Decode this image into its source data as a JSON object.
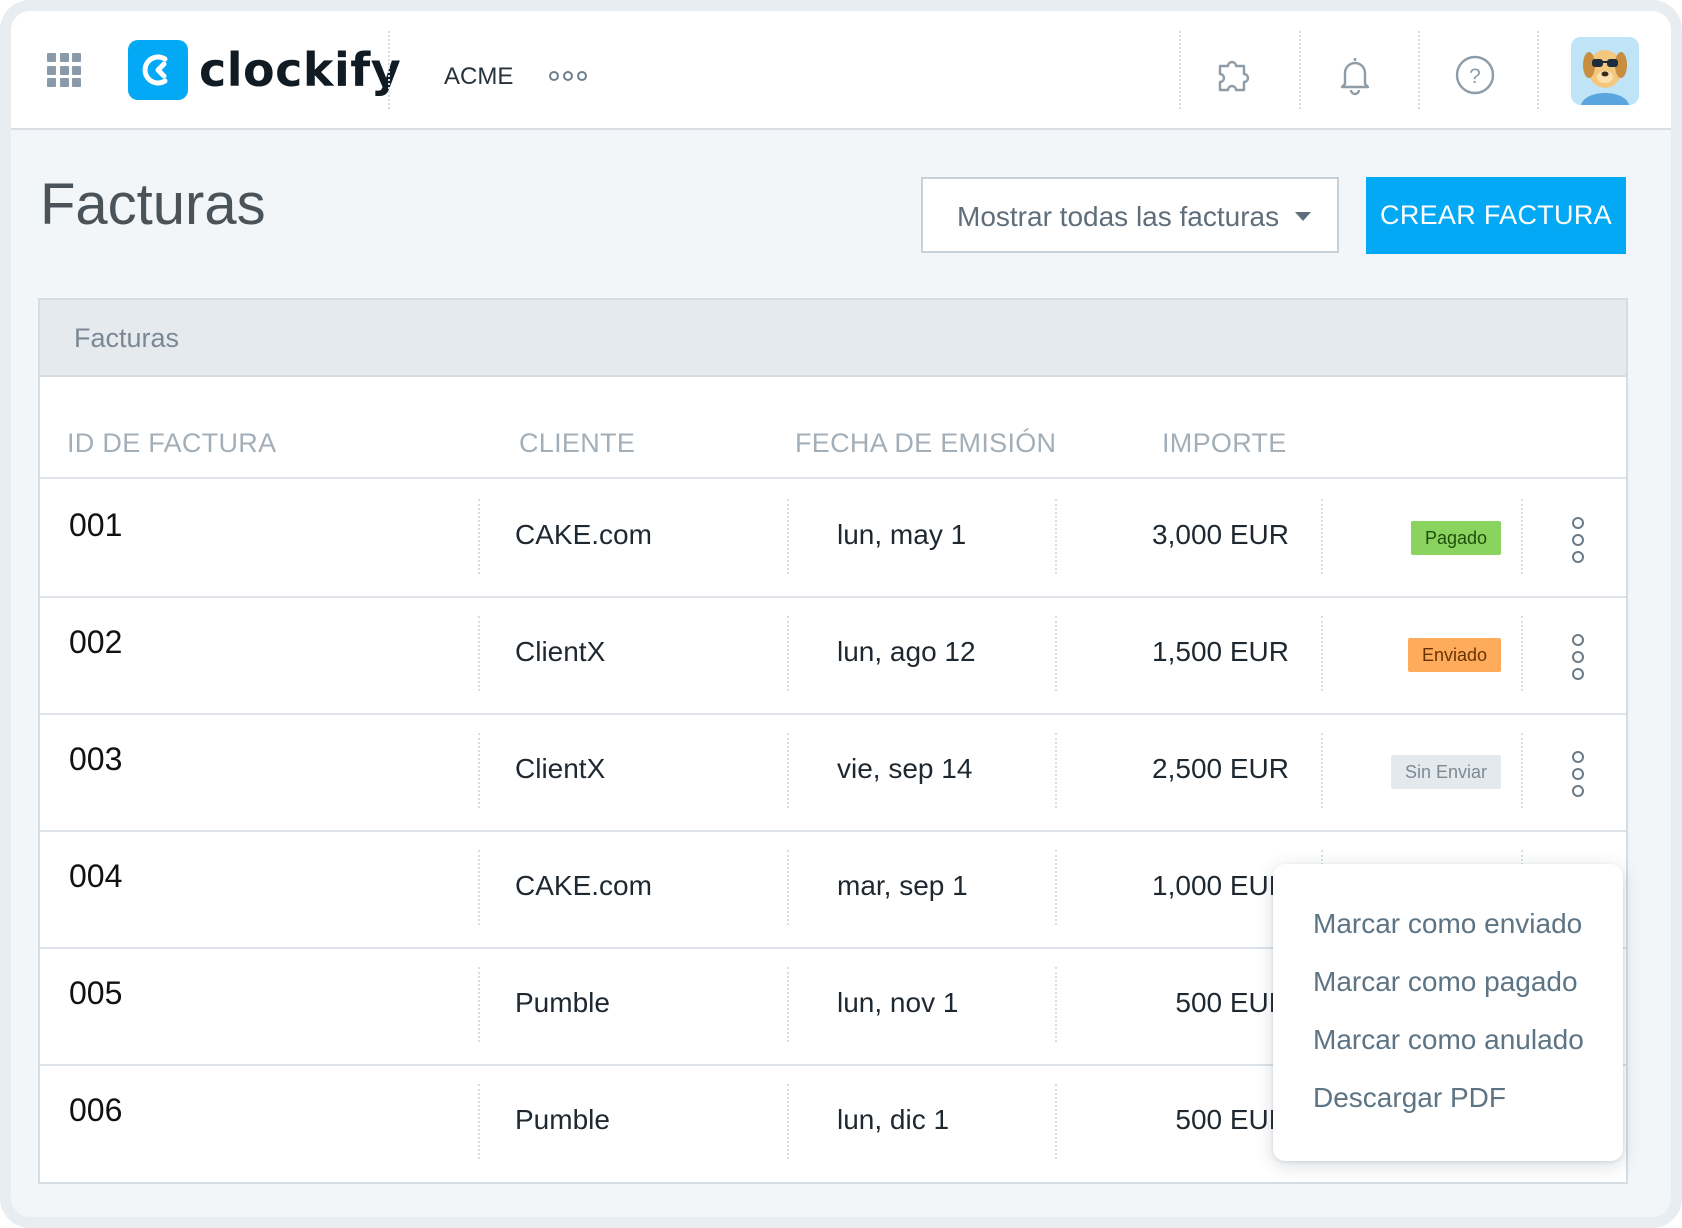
{
  "header": {
    "logo_text": "clockify",
    "workspace": "ACME"
  },
  "page": {
    "title": "Facturas",
    "filter_label": "Mostrar todas las facturas",
    "create_button": "CREAR FACTURA"
  },
  "table": {
    "title": "Facturas",
    "columns": [
      "ID DE FACTURA",
      "CLIENTE",
      "FECHA DE EMISIÓN",
      "IMPORTE"
    ],
    "rows": [
      {
        "id": "001",
        "client": "CAKE.com",
        "date": "lun, may 1",
        "amount": "3,000 EUR",
        "status": "Pagado"
      },
      {
        "id": "002",
        "client": "ClientX",
        "date": "lun, ago 12",
        "amount": "1,500 EUR",
        "status": "Enviado"
      },
      {
        "id": "003",
        "client": "ClientX",
        "date": "vie, sep 14",
        "amount": "2,500 EUR",
        "status": "Sin Enviar"
      },
      {
        "id": "004",
        "client": "CAKE.com",
        "date": "mar, sep 1",
        "amount": "1,000 EUR",
        "status": ""
      },
      {
        "id": "005",
        "client": "Pumble",
        "date": "lun, nov 1",
        "amount": "500 EUR",
        "status": ""
      },
      {
        "id": "006",
        "client": "Pumble",
        "date": "lun, dic 1",
        "amount": "500 EUR",
        "status": ""
      }
    ]
  },
  "context_menu": {
    "items": [
      "Marcar como enviado",
      "Marcar como pagado",
      "Marcar como anulado",
      "Descargar PDF"
    ]
  },
  "colors": {
    "brand": "#03a9f4",
    "paid": "#8bd35f",
    "sent": "#ffab5c",
    "draft": "#e4e9ed"
  }
}
